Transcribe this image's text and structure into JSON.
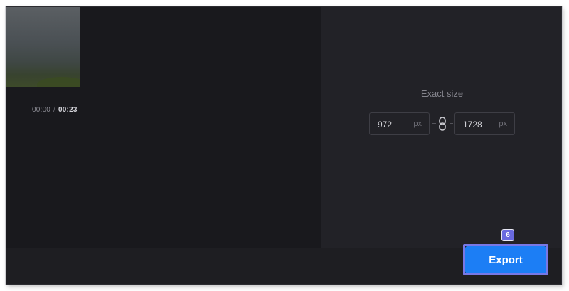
{
  "player": {
    "current_time": "00:00",
    "separator": "/",
    "duration": "00:23"
  },
  "size": {
    "title": "Exact size",
    "width_value": "972",
    "width_unit": "px",
    "height_value": "1728",
    "height_unit": "px",
    "link_icon": "chain-link-icon"
  },
  "footer": {
    "step_badge": "6",
    "export_label": "Export"
  },
  "colors": {
    "accent": "#1c7ef5",
    "highlight": "#7878e6"
  }
}
